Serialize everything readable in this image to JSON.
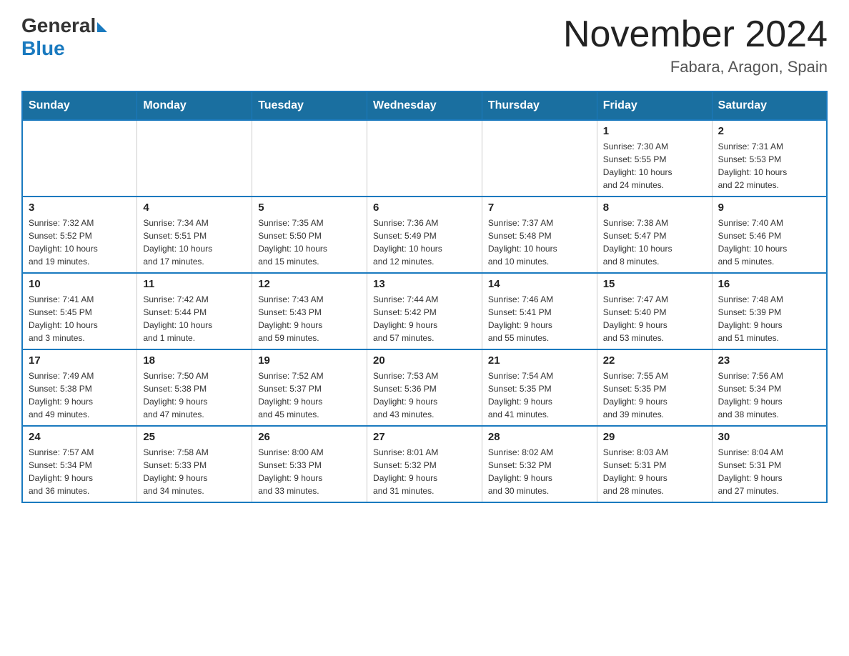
{
  "logo": {
    "general": "General",
    "blue": "Blue"
  },
  "title": "November 2024",
  "location": "Fabara, Aragon, Spain",
  "days_of_week": [
    "Sunday",
    "Monday",
    "Tuesday",
    "Wednesday",
    "Thursday",
    "Friday",
    "Saturday"
  ],
  "weeks": [
    {
      "days": [
        {
          "num": "",
          "info": ""
        },
        {
          "num": "",
          "info": ""
        },
        {
          "num": "",
          "info": ""
        },
        {
          "num": "",
          "info": ""
        },
        {
          "num": "",
          "info": ""
        },
        {
          "num": "1",
          "info": "Sunrise: 7:30 AM\nSunset: 5:55 PM\nDaylight: 10 hours\nand 24 minutes."
        },
        {
          "num": "2",
          "info": "Sunrise: 7:31 AM\nSunset: 5:53 PM\nDaylight: 10 hours\nand 22 minutes."
        }
      ]
    },
    {
      "days": [
        {
          "num": "3",
          "info": "Sunrise: 7:32 AM\nSunset: 5:52 PM\nDaylight: 10 hours\nand 19 minutes."
        },
        {
          "num": "4",
          "info": "Sunrise: 7:34 AM\nSunset: 5:51 PM\nDaylight: 10 hours\nand 17 minutes."
        },
        {
          "num": "5",
          "info": "Sunrise: 7:35 AM\nSunset: 5:50 PM\nDaylight: 10 hours\nand 15 minutes."
        },
        {
          "num": "6",
          "info": "Sunrise: 7:36 AM\nSunset: 5:49 PM\nDaylight: 10 hours\nand 12 minutes."
        },
        {
          "num": "7",
          "info": "Sunrise: 7:37 AM\nSunset: 5:48 PM\nDaylight: 10 hours\nand 10 minutes."
        },
        {
          "num": "8",
          "info": "Sunrise: 7:38 AM\nSunset: 5:47 PM\nDaylight: 10 hours\nand 8 minutes."
        },
        {
          "num": "9",
          "info": "Sunrise: 7:40 AM\nSunset: 5:46 PM\nDaylight: 10 hours\nand 5 minutes."
        }
      ]
    },
    {
      "days": [
        {
          "num": "10",
          "info": "Sunrise: 7:41 AM\nSunset: 5:45 PM\nDaylight: 10 hours\nand 3 minutes."
        },
        {
          "num": "11",
          "info": "Sunrise: 7:42 AM\nSunset: 5:44 PM\nDaylight: 10 hours\nand 1 minute."
        },
        {
          "num": "12",
          "info": "Sunrise: 7:43 AM\nSunset: 5:43 PM\nDaylight: 9 hours\nand 59 minutes."
        },
        {
          "num": "13",
          "info": "Sunrise: 7:44 AM\nSunset: 5:42 PM\nDaylight: 9 hours\nand 57 minutes."
        },
        {
          "num": "14",
          "info": "Sunrise: 7:46 AM\nSunset: 5:41 PM\nDaylight: 9 hours\nand 55 minutes."
        },
        {
          "num": "15",
          "info": "Sunrise: 7:47 AM\nSunset: 5:40 PM\nDaylight: 9 hours\nand 53 minutes."
        },
        {
          "num": "16",
          "info": "Sunrise: 7:48 AM\nSunset: 5:39 PM\nDaylight: 9 hours\nand 51 minutes."
        }
      ]
    },
    {
      "days": [
        {
          "num": "17",
          "info": "Sunrise: 7:49 AM\nSunset: 5:38 PM\nDaylight: 9 hours\nand 49 minutes."
        },
        {
          "num": "18",
          "info": "Sunrise: 7:50 AM\nSunset: 5:38 PM\nDaylight: 9 hours\nand 47 minutes."
        },
        {
          "num": "19",
          "info": "Sunrise: 7:52 AM\nSunset: 5:37 PM\nDaylight: 9 hours\nand 45 minutes."
        },
        {
          "num": "20",
          "info": "Sunrise: 7:53 AM\nSunset: 5:36 PM\nDaylight: 9 hours\nand 43 minutes."
        },
        {
          "num": "21",
          "info": "Sunrise: 7:54 AM\nSunset: 5:35 PM\nDaylight: 9 hours\nand 41 minutes."
        },
        {
          "num": "22",
          "info": "Sunrise: 7:55 AM\nSunset: 5:35 PM\nDaylight: 9 hours\nand 39 minutes."
        },
        {
          "num": "23",
          "info": "Sunrise: 7:56 AM\nSunset: 5:34 PM\nDaylight: 9 hours\nand 38 minutes."
        }
      ]
    },
    {
      "days": [
        {
          "num": "24",
          "info": "Sunrise: 7:57 AM\nSunset: 5:34 PM\nDaylight: 9 hours\nand 36 minutes."
        },
        {
          "num": "25",
          "info": "Sunrise: 7:58 AM\nSunset: 5:33 PM\nDaylight: 9 hours\nand 34 minutes."
        },
        {
          "num": "26",
          "info": "Sunrise: 8:00 AM\nSunset: 5:33 PM\nDaylight: 9 hours\nand 33 minutes."
        },
        {
          "num": "27",
          "info": "Sunrise: 8:01 AM\nSunset: 5:32 PM\nDaylight: 9 hours\nand 31 minutes."
        },
        {
          "num": "28",
          "info": "Sunrise: 8:02 AM\nSunset: 5:32 PM\nDaylight: 9 hours\nand 30 minutes."
        },
        {
          "num": "29",
          "info": "Sunrise: 8:03 AM\nSunset: 5:31 PM\nDaylight: 9 hours\nand 28 minutes."
        },
        {
          "num": "30",
          "info": "Sunrise: 8:04 AM\nSunset: 5:31 PM\nDaylight: 9 hours\nand 27 minutes."
        }
      ]
    }
  ]
}
